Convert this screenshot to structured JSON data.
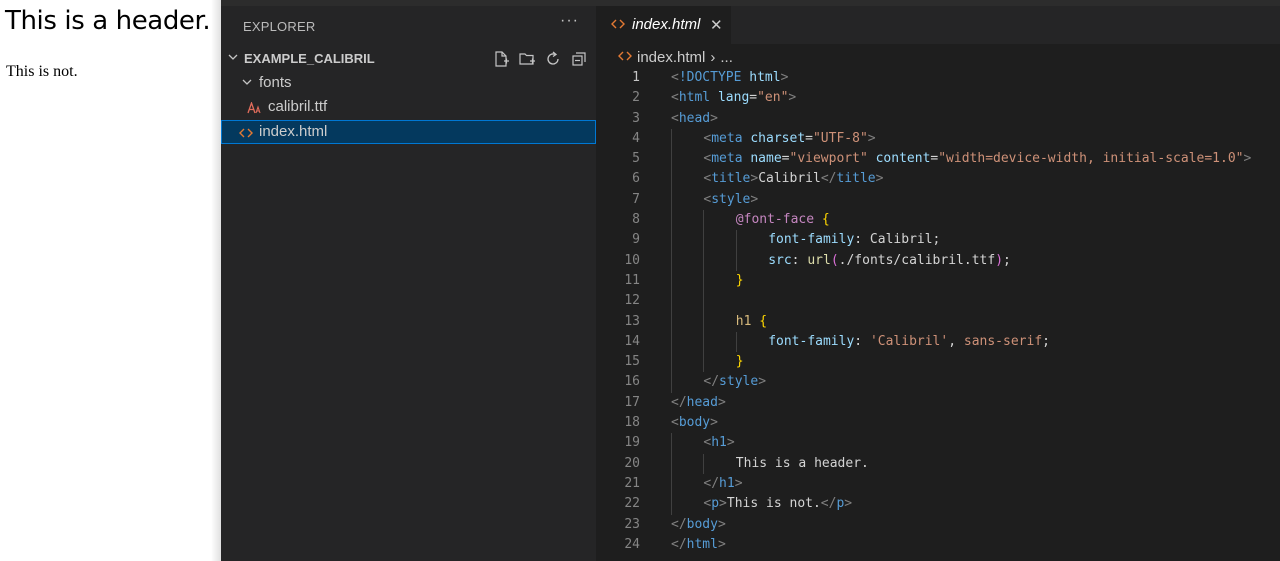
{
  "preview": {
    "header_text": "This is a header.",
    "paragraph_text": "This is not."
  },
  "explorer": {
    "title": "EXPLORER",
    "more_label": "···",
    "folder_name": "EXAMPLE_CALIBRIL",
    "items": [
      {
        "label": "fonts",
        "type": "folder"
      },
      {
        "label": "calibril.ttf",
        "type": "font-file"
      },
      {
        "label": "index.html",
        "type": "html-file",
        "selected": true
      }
    ],
    "icons": [
      "new-file-icon",
      "new-folder-icon",
      "refresh-icon",
      "collapse-all-icon"
    ]
  },
  "editor": {
    "tab_label": "index.html",
    "close_glyph": "✕",
    "breadcrumb_file": "index.html",
    "breadcrumb_sep": "›",
    "breadcrumb_more": "...",
    "active_line": 1,
    "lines": [
      {
        "n": "1",
        "indent": 0,
        "tokens": [
          [
            "angle",
            "<"
          ],
          [
            "tag",
            "!DOCTYPE"
          ],
          [
            "text",
            " "
          ],
          [
            "attr",
            "html"
          ],
          [
            "angle",
            ">"
          ]
        ]
      },
      {
        "n": "2",
        "indent": 0,
        "tokens": [
          [
            "angle",
            "<"
          ],
          [
            "tag",
            "html"
          ],
          [
            "text",
            " "
          ],
          [
            "attr",
            "lang"
          ],
          [
            "text",
            "="
          ],
          [
            "str",
            "\"en\""
          ],
          [
            "angle",
            ">"
          ]
        ]
      },
      {
        "n": "3",
        "indent": 0,
        "tokens": [
          [
            "angle",
            "<"
          ],
          [
            "tag",
            "head"
          ],
          [
            "angle",
            ">"
          ]
        ]
      },
      {
        "n": "4",
        "indent": 1,
        "tokens": [
          [
            "angle",
            "<"
          ],
          [
            "tag",
            "meta"
          ],
          [
            "text",
            " "
          ],
          [
            "attr",
            "charset"
          ],
          [
            "text",
            "="
          ],
          [
            "str",
            "\"UTF-8\""
          ],
          [
            "angle",
            ">"
          ]
        ]
      },
      {
        "n": "5",
        "indent": 1,
        "tokens": [
          [
            "angle",
            "<"
          ],
          [
            "tag",
            "meta"
          ],
          [
            "text",
            " "
          ],
          [
            "attr",
            "name"
          ],
          [
            "text",
            "="
          ],
          [
            "str",
            "\"viewport\""
          ],
          [
            "text",
            " "
          ],
          [
            "attr",
            "content"
          ],
          [
            "text",
            "="
          ],
          [
            "str",
            "\"width=device-width, initial-scale=1.0\""
          ],
          [
            "angle",
            ">"
          ]
        ]
      },
      {
        "n": "6",
        "indent": 1,
        "tokens": [
          [
            "angle",
            "<"
          ],
          [
            "tag",
            "title"
          ],
          [
            "angle",
            ">"
          ],
          [
            "text",
            "Calibril"
          ],
          [
            "angle",
            "</"
          ],
          [
            "tag",
            "title"
          ],
          [
            "angle",
            ">"
          ]
        ]
      },
      {
        "n": "7",
        "indent": 1,
        "tokens": [
          [
            "angle",
            "<"
          ],
          [
            "tag",
            "style"
          ],
          [
            "angle",
            ">"
          ]
        ]
      },
      {
        "n": "8",
        "indent": 2,
        "tokens": [
          [
            "at",
            "@font-face"
          ],
          [
            "text",
            " "
          ],
          [
            "brace",
            "{"
          ]
        ]
      },
      {
        "n": "9",
        "indent": 3,
        "tokens": [
          [
            "prop",
            "font-family"
          ],
          [
            "text",
            ": Calibril;"
          ]
        ]
      },
      {
        "n": "10",
        "indent": 3,
        "tokens": [
          [
            "prop",
            "src"
          ],
          [
            "text",
            ": "
          ],
          [
            "fn",
            "url"
          ],
          [
            "paren",
            "("
          ],
          [
            "text",
            "./fonts/calibril.ttf"
          ],
          [
            "paren",
            ")"
          ],
          [
            "text",
            ";"
          ]
        ]
      },
      {
        "n": "11",
        "indent": 2,
        "tokens": [
          [
            "brace",
            "}"
          ]
        ]
      },
      {
        "n": "12",
        "indent": 2,
        "tokens": []
      },
      {
        "n": "13",
        "indent": 2,
        "tokens": [
          [
            "sel",
            "h1"
          ],
          [
            "text",
            " "
          ],
          [
            "brace",
            "{"
          ]
        ]
      },
      {
        "n": "14",
        "indent": 3,
        "tokens": [
          [
            "prop",
            "font-family"
          ],
          [
            "text",
            ": "
          ],
          [
            "str",
            "'Calibril'"
          ],
          [
            "text",
            ", "
          ],
          [
            "str",
            "sans-serif"
          ],
          [
            "text",
            ";"
          ]
        ]
      },
      {
        "n": "15",
        "indent": 2,
        "tokens": [
          [
            "brace",
            "}"
          ]
        ]
      },
      {
        "n": "16",
        "indent": 1,
        "tokens": [
          [
            "angle",
            "</"
          ],
          [
            "tag",
            "style"
          ],
          [
            "angle",
            ">"
          ]
        ]
      },
      {
        "n": "17",
        "indent": 0,
        "tokens": [
          [
            "angle",
            "</"
          ],
          [
            "tag",
            "head"
          ],
          [
            "angle",
            ">"
          ]
        ]
      },
      {
        "n": "18",
        "indent": 0,
        "tokens": [
          [
            "angle",
            "<"
          ],
          [
            "tag",
            "body"
          ],
          [
            "angle",
            ">"
          ]
        ]
      },
      {
        "n": "19",
        "indent": 1,
        "tokens": [
          [
            "angle",
            "<"
          ],
          [
            "tag",
            "h1"
          ],
          [
            "angle",
            ">"
          ]
        ]
      },
      {
        "n": "20",
        "indent": 2,
        "tokens": [
          [
            "text",
            "This is a header."
          ]
        ]
      },
      {
        "n": "21",
        "indent": 1,
        "tokens": [
          [
            "angle",
            "</"
          ],
          [
            "tag",
            "h1"
          ],
          [
            "angle",
            ">"
          ]
        ]
      },
      {
        "n": "22",
        "indent": 1,
        "tokens": [
          [
            "angle",
            "<"
          ],
          [
            "tag",
            "p"
          ],
          [
            "angle",
            ">"
          ],
          [
            "text",
            "This is not."
          ],
          [
            "angle",
            "</"
          ],
          [
            "tag",
            "p"
          ],
          [
            "angle",
            ">"
          ]
        ]
      },
      {
        "n": "23",
        "indent": 0,
        "tokens": [
          [
            "angle",
            "</"
          ],
          [
            "tag",
            "body"
          ],
          [
            "angle",
            ">"
          ]
        ]
      },
      {
        "n": "24",
        "indent": 0,
        "tokens": [
          [
            "angle",
            "</"
          ],
          [
            "tag",
            "html"
          ],
          [
            "angle",
            ">"
          ]
        ]
      }
    ]
  },
  "colors": {
    "sidebar_bg": "#252526",
    "editor_bg": "#1e1e1e",
    "selection_bg": "#04395e",
    "selection_border": "#0078d4",
    "tag": "#569cd6",
    "attr": "#9cdcfe",
    "string": "#ce9178"
  }
}
